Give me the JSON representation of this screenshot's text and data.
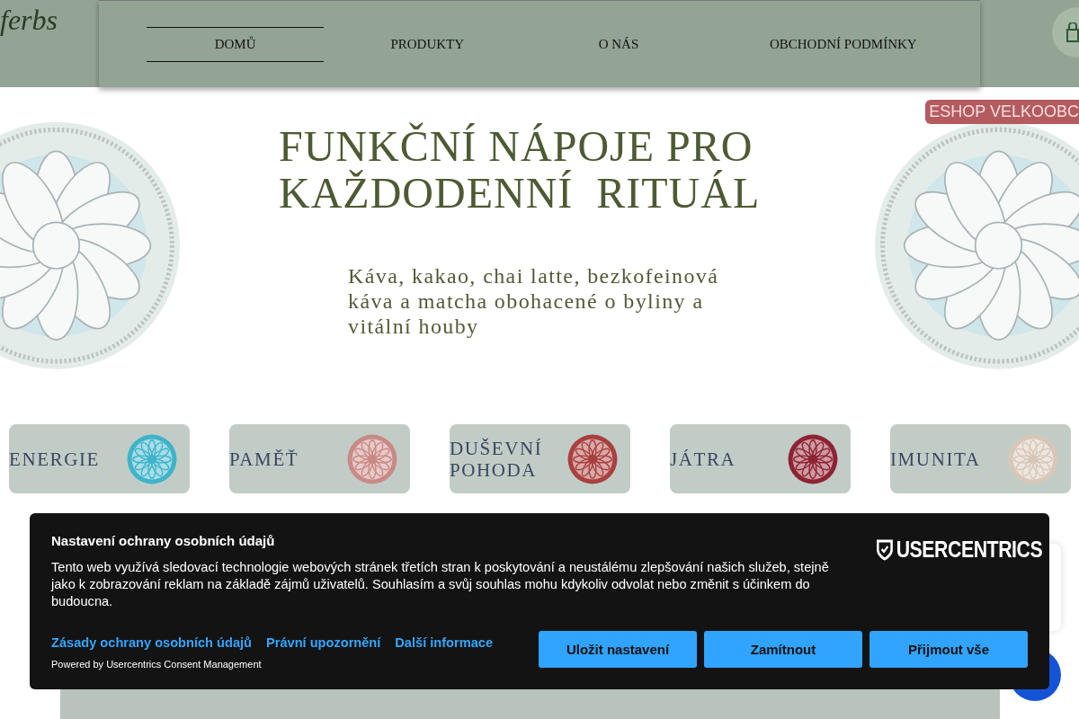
{
  "header": {
    "logo": "ferbs",
    "nav": [
      {
        "label": "DOMŮ",
        "selected": true
      },
      {
        "label": "PRODUKTY",
        "selected": false
      },
      {
        "label": "O NÁS",
        "selected": false
      },
      {
        "label": "OBCHODNÍ PODMÍNKY",
        "selected": false
      }
    ]
  },
  "hero": {
    "badge": "ESHOP VELKOOBC",
    "title": "FUNKČNÍ NÁPOJE PRO\nKAŽDODENNÍ  RITUÁL",
    "subtitle": "Káva, kakao, chai latte, bezkofeinová\nkáva a matcha obohacené o byliny a\nvitální houby"
  },
  "categories": [
    {
      "label": "ENERGIE",
      "color": "#3fb3c9"
    },
    {
      "label": "PAMĚŤ",
      "color": "#c98a86"
    },
    {
      "label": "DUŠEVNÍ\nPOHODA",
      "color": "#a8403f"
    },
    {
      "label": "JÁTRA",
      "color": "#8e2333"
    },
    {
      "label": "IMUNITA",
      "color": "#d8c7b8"
    }
  ],
  "consent": {
    "title": "Nastavení ochrany osobních údajů",
    "brand": "USERCENTRICS",
    "text": "Tento web využívá sledovací technologie webových stránek třetích stran k poskytování a neustálému zlepšování našich služeb, stejně jako k zobrazování reklam na základě zájmů uživatelů. Souhlasím a svůj souhlas mohu kdykoliv odvolat nebo změnit s účinkem do budoucna.",
    "links": [
      "Zásady ochrany osobních údajů",
      "Právní upozornění",
      "Další informace"
    ],
    "powered": "Powered by Usercentrics Consent Management",
    "buttons": [
      "Uložit nastavení",
      "Zamítnout",
      "Přijmout vše"
    ]
  }
}
